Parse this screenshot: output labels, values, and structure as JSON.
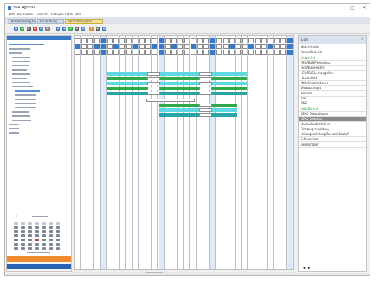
{
  "window": {
    "title": "SPM Agenda",
    "controls": [
      "–",
      "□",
      "✕"
    ]
  },
  "menu": [
    "Datei",
    "Bearbeiten",
    "Ansicht",
    "Einfügen",
    "Extras",
    "Hilfe"
  ],
  "tabs": [
    {
      "label": "Terminplanung Gesamt",
      "active": false
    },
    {
      "label": "Kursplanung",
      "active": false
    },
    {
      "label": "Benutzerausgabe",
      "active": true
    }
  ],
  "toolbar": [
    "new-icon",
    "save-icon",
    "print-icon",
    "cut-icon",
    "copy-icon",
    "paste-icon",
    "undo-icon",
    "redo-icon",
    "grid-view-icon",
    "list-view-icon",
    "zoom-icon",
    "filter-icon",
    "settings-icon",
    "help-icon"
  ],
  "grid": {
    "columns": 34,
    "highlighted_columns": [
      4,
      13,
      21,
      33
    ],
    "bars": [
      {
        "color": "cyan",
        "label": ""
      },
      {
        "color": "green",
        "label": ""
      },
      {
        "color": "cyan",
        "label": ""
      },
      {
        "color": "green",
        "label": ""
      },
      {
        "color": "teal",
        "label": ""
      },
      {
        "color": "white",
        "label": ""
      },
      {
        "color": "green",
        "label": ""
      },
      {
        "color": "cyan",
        "label": ""
      },
      {
        "color": "teal",
        "label": ""
      }
    ]
  },
  "right_panel": {
    "header": "Liste",
    "close": "×",
    "items": [
      {
        "label": "Modulatlantis",
        "style": "normal"
      },
      {
        "label": "Baustellenleiter",
        "style": "normal"
      },
      {
        "label": "Kruger 3.0",
        "style": "green"
      },
      {
        "label": "HERAEUS Pflegeplatz",
        "style": "normal"
      },
      {
        "label": "HERAEUS Freizeit",
        "style": "normal"
      },
      {
        "label": "HERAEUS Lernbegleiter",
        "style": "normal"
      },
      {
        "label": "Hausbetrieb",
        "style": "normal"
      },
      {
        "label": "Modulinformationen",
        "style": "normal"
      },
      {
        "label": "Verbrauchsgut",
        "style": "normal"
      },
      {
        "label": "Wohnen",
        "style": "normal"
      },
      {
        "label": "RNS",
        "style": "normal"
      },
      {
        "label": "BWS",
        "style": "normal"
      },
      {
        "label": "KADI Zentral",
        "style": "green"
      },
      {
        "label": "DSAG Gebaudeplan",
        "style": "normal"
      },
      {
        "label": "DSAG Kurzplatz",
        "style": "selected"
      },
      {
        "label": "Hoerbehindertenkurs",
        "style": "normal"
      },
      {
        "label": "Fahrzeugverwaltung",
        "style": "normal"
      },
      {
        "label": "Uebungsschulung Buesum Bauhof",
        "style": "normal"
      },
      {
        "label": "Schlusselbar",
        "style": "normal"
      },
      {
        "label": "Baumanager",
        "style": "normal"
      }
    ],
    "footer_icons": "▼ ▼"
  },
  "colors": {
    "accent": "#3a78c8",
    "bar_cyan": "#5ed9e2",
    "bar_green": "#2fa84a",
    "bar_teal": "#29a3a3",
    "orange": "#f08c2e",
    "calendar_today": "#d63a3a"
  }
}
